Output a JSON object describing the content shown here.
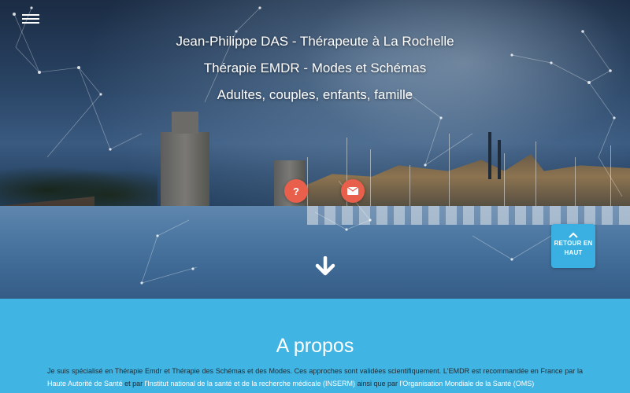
{
  "hero": {
    "title_line1": "Jean-Philippe DAS - Thérapeute à La Rochelle",
    "title_line2": "Thérapie EMDR - Modes et Schémas",
    "title_line3": "Adultes, couples, enfants, famille",
    "help_icon": "question-circle-icon",
    "mail_icon": "envelope-icon",
    "help_glyph": "?",
    "scroll_icon": "arrow-down-icon"
  },
  "menu": {
    "icon": "hamburger-menu-icon"
  },
  "back_to_top": {
    "label": "RETOUR EN HAUT",
    "icon": "chevron-up-icon"
  },
  "about": {
    "heading": "A propos",
    "text_1": "Je suis spécialisé en Thérapie Emdr et Thérapie des Schémas et des Modes. Ces approches sont validées scientifiquement. L'EMDR est recommandée en France par la ",
    "link_has": "Haute Autorité de Santé",
    "text_2": " et par ",
    "link_inserm": "l'Institut national de la santé et de la recherche médicale (INSERM)",
    "text_3": " ainsi que par ",
    "link_oms": "l'Organisation Mondiale de la Santé (OMS)"
  },
  "colors": {
    "accent_button": "#e8604c",
    "section_blue": "#40b4e2",
    "back_to_top_bg": "#3ab0e2"
  }
}
